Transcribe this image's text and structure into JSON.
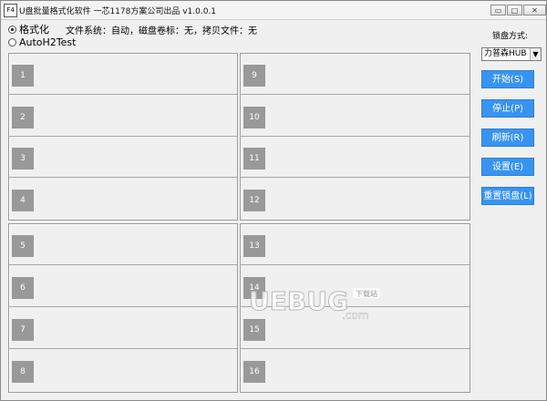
{
  "window": {
    "icon_text": "F4",
    "title": "U盘批量格式化软件  一芯1178方案公司出品 v1.0.0.1",
    "buttons": {
      "minimize": "▭",
      "maximize": "□",
      "close": "✕"
    }
  },
  "mode": {
    "format_label": "格式化",
    "test_label": "AutoH2Test",
    "selected": "format",
    "status": "文件系统：自动，磁盘卷标：无，拷贝文件：无"
  },
  "slots": [
    "1",
    "2",
    "3",
    "4",
    "5",
    "6",
    "7",
    "8",
    "9",
    "10",
    "11",
    "12",
    "13",
    "14",
    "15",
    "16"
  ],
  "sidebar": {
    "method_label": "锁盘方式:",
    "method_value": "力普森HUB",
    "buttons": {
      "start": "开始(S)",
      "stop": "停止(P)",
      "refresh": "刷新(R)",
      "settings": "设置(E)",
      "reset": "重置锁盘(L)"
    }
  },
  "watermark": {
    "brand": "UEBUG",
    "sub": ".com",
    "tag": "下载站"
  },
  "colors": {
    "button": "#3894f0",
    "slot_badge": "#999999",
    "background": "#f0f0f0"
  }
}
